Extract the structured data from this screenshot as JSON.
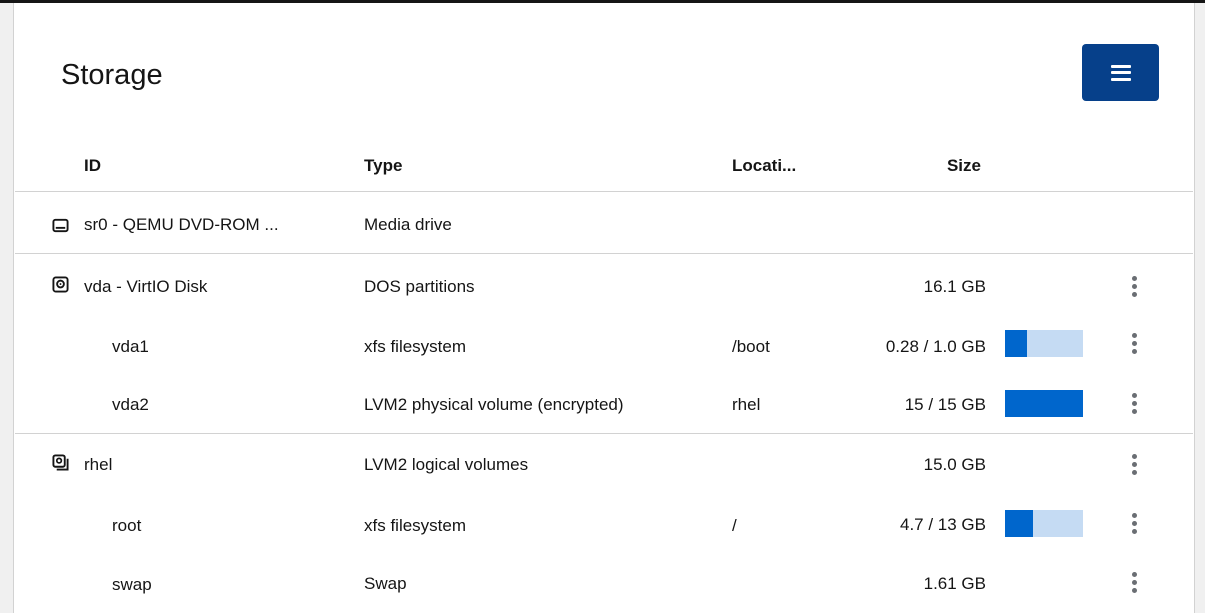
{
  "card": {
    "title": "Storage",
    "menu_icon": "hamburger-menu-icon"
  },
  "columns": {
    "id": "ID",
    "type": "Type",
    "location": "Locati...",
    "size": "Size"
  },
  "rows": [
    {
      "id": "sr0 - QEMU DVD-ROM ...",
      "type": "Media drive",
      "location": "",
      "size": "",
      "icon": "optical-drive-icon",
      "has_menu": false
    },
    {
      "id": "vda - VirtIO Disk",
      "type": "DOS partitions",
      "location": "",
      "size": "16.1 GB",
      "icon": "hard-disk-icon",
      "has_menu": true
    },
    {
      "id": "vda1",
      "type": "xfs filesystem",
      "location": "/boot",
      "size": "0.28 / 1.0 GB",
      "usage": 0.28,
      "has_menu": true
    },
    {
      "id": "vda2",
      "type": "LVM2 physical volume (encrypted)",
      "location": "rhel",
      "size": "15 / 15 GB",
      "usage": 1.0,
      "has_menu": true
    },
    {
      "id": "rhel",
      "type": "LVM2 logical volumes",
      "location": "",
      "size": "15.0 GB",
      "icon": "volume-group-icon",
      "has_menu": true
    },
    {
      "id": "root",
      "type": "xfs filesystem",
      "location": "/",
      "size": "4.7 / 13 GB",
      "usage": 0.36,
      "has_menu": true
    },
    {
      "id": "swap",
      "type": "Swap",
      "location": "",
      "size": "1.61 GB",
      "has_menu": true
    }
  ],
  "colors": {
    "primary": "#06408a",
    "usage_fill": "#0066cc",
    "usage_track": "#c5dbf3"
  }
}
